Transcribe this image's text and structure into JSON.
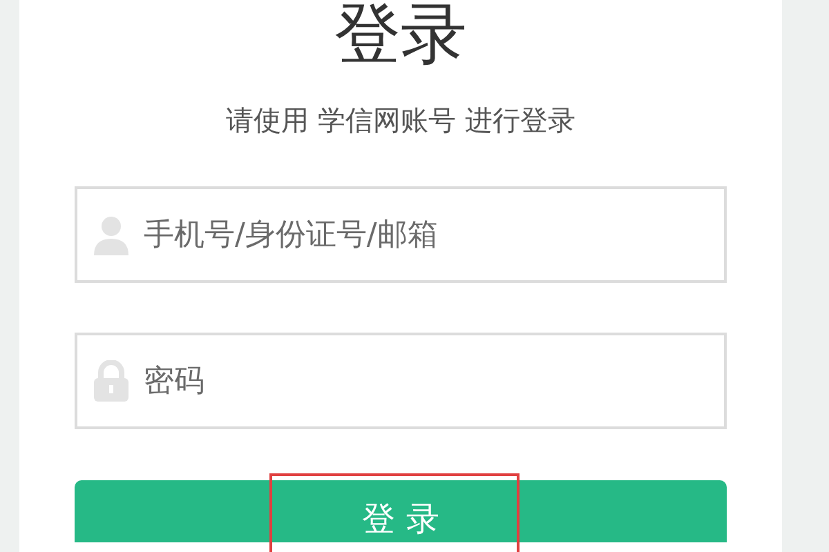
{
  "title": "登录",
  "subtitle": "请使用 学信网账号 进行登录",
  "fields": [
    {
      "kind": "user",
      "placeholder": "手机号/身份证号/邮箱"
    },
    {
      "kind": "password",
      "placeholder": "密码"
    }
  ],
  "login_button": "登 录"
}
